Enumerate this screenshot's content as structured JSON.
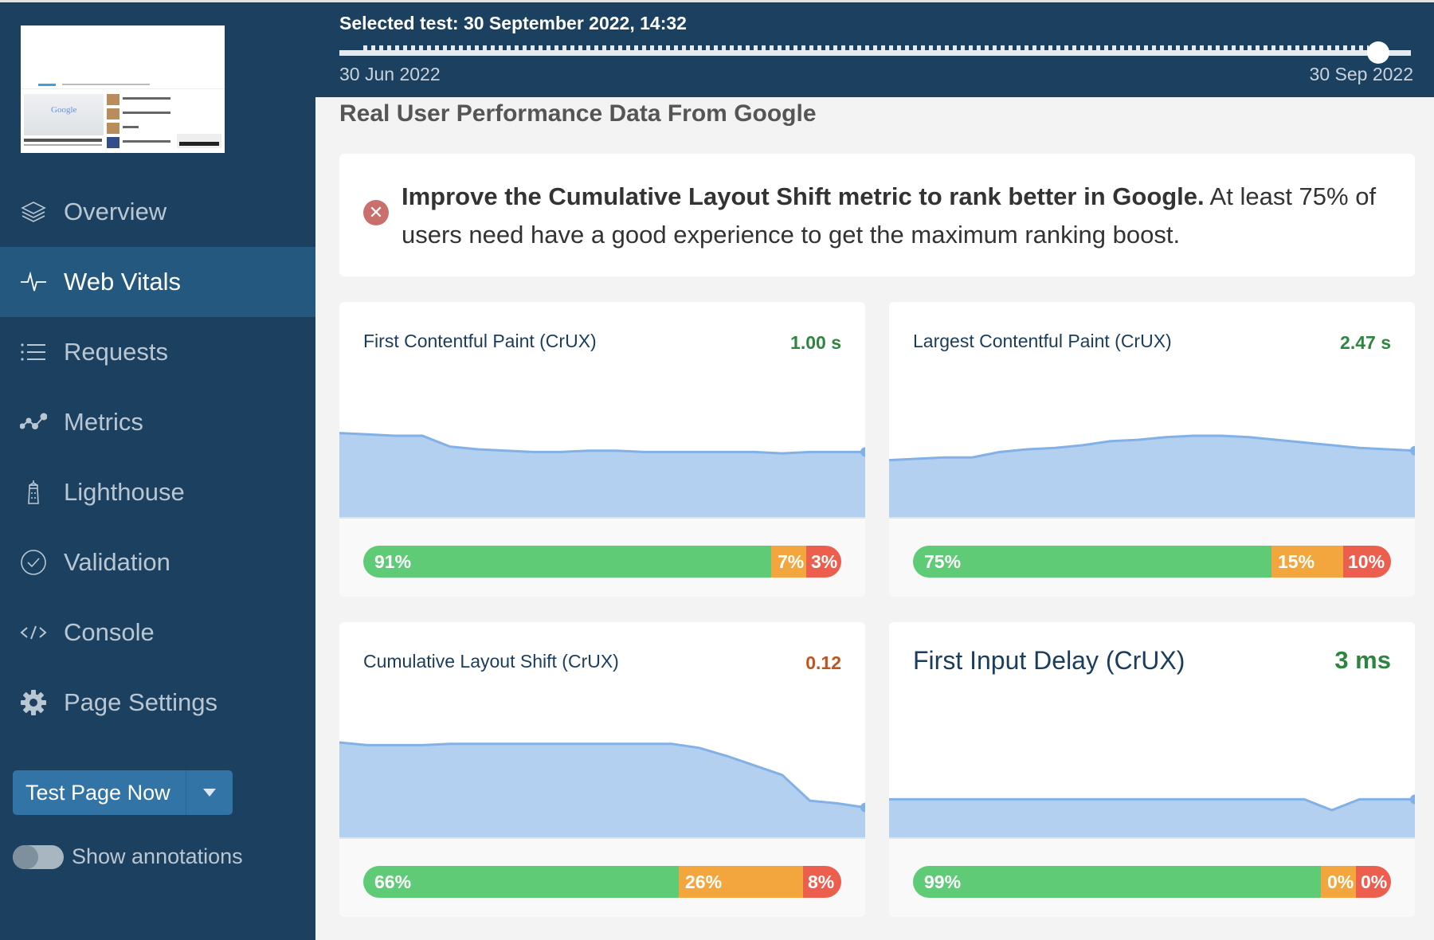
{
  "sidebar": {
    "items": [
      {
        "label": "Overview",
        "icon": "layers-icon",
        "active": false
      },
      {
        "label": "Web Vitals",
        "icon": "pulse-icon",
        "active": true
      },
      {
        "label": "Requests",
        "icon": "list-icon",
        "active": false
      },
      {
        "label": "Metrics",
        "icon": "line-chart-icon",
        "active": false
      },
      {
        "label": "Lighthouse",
        "icon": "lighthouse-icon",
        "active": false
      },
      {
        "label": "Validation",
        "icon": "check-circle-icon",
        "active": false
      },
      {
        "label": "Console",
        "icon": "code-icon",
        "active": false
      },
      {
        "label": "Page Settings",
        "icon": "gear-icon",
        "active": false
      }
    ],
    "test_button_label": "Test Page Now",
    "annotations_label": "Show annotations",
    "annotations_on": false
  },
  "header": {
    "selected_test": "Selected test: 30 September 2022, 14:32",
    "range_start": "30 Jun 2022",
    "range_end": "30 Sep 2022",
    "slider_position": 0.98
  },
  "main": {
    "section_title": "Real User Performance Data From Google",
    "alert": {
      "bold": "Improve the Cumulative Layout Shift metric to rank better in Google.",
      "rest": " At least 75% of users need have a good experience to get the maximum ranking boost."
    }
  },
  "colors": {
    "good": "#5fcb77",
    "needs_improvement": "#f2a63d",
    "poor": "#ec5f4f",
    "value_good": "#2e8540",
    "value_ni": "#c0541e",
    "area_fill": "#b3d0f0",
    "area_line": "#82b1e6"
  },
  "chart_data": [
    {
      "type": "area",
      "title": "First Contentful Paint (CrUX)",
      "value": "1.00 s",
      "status": "good",
      "series": [
        0.62,
        0.61,
        0.6,
        0.6,
        0.52,
        0.5,
        0.49,
        0.48,
        0.48,
        0.49,
        0.49,
        0.48,
        0.48,
        0.48,
        0.48,
        0.48,
        0.47,
        0.48,
        0.48,
        0.48
      ],
      "distribution": {
        "good": 91,
        "needs_improvement": 7,
        "poor": 3
      }
    },
    {
      "type": "area",
      "title": "Largest Contentful Paint (CrUX)",
      "value": "2.47 s",
      "status": "good",
      "series": [
        0.42,
        0.43,
        0.44,
        0.44,
        0.48,
        0.5,
        0.51,
        0.53,
        0.56,
        0.57,
        0.59,
        0.6,
        0.6,
        0.59,
        0.57,
        0.55,
        0.53,
        0.51,
        0.5,
        0.49
      ],
      "distribution": {
        "good": 75,
        "needs_improvement": 15,
        "poor": 10
      }
    },
    {
      "type": "area",
      "title": "Cumulative Layout Shift (CrUX)",
      "value": "0.12",
      "status": "needs_improvement",
      "series": [
        0.7,
        0.68,
        0.68,
        0.68,
        0.69,
        0.69,
        0.69,
        0.69,
        0.69,
        0.69,
        0.69,
        0.69,
        0.69,
        0.66,
        0.6,
        0.53,
        0.46,
        0.27,
        0.25,
        0.22
      ],
      "distribution": {
        "good": 66,
        "needs_improvement": 26,
        "poor": 8
      }
    },
    {
      "type": "area",
      "title": "First Input Delay (CrUX)",
      "value": "3 ms",
      "status": "good",
      "series": [
        0.28,
        0.28,
        0.28,
        0.28,
        0.28,
        0.28,
        0.28,
        0.28,
        0.28,
        0.28,
        0.28,
        0.28,
        0.28,
        0.28,
        0.28,
        0.28,
        0.2,
        0.28,
        0.28,
        0.28
      ],
      "distribution": {
        "good": 99,
        "needs_improvement": 0,
        "poor": 0
      }
    }
  ]
}
